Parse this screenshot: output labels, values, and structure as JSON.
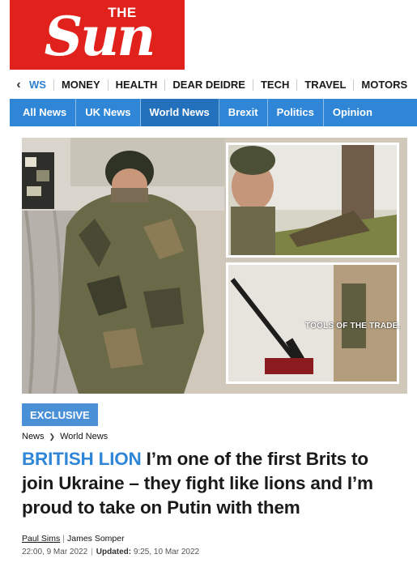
{
  "logo": {
    "the": "THE",
    "sun": "Sun"
  },
  "top_nav": {
    "items": [
      "WS",
      "MONEY",
      "HEALTH",
      "DEAR DEIDRE",
      "TECH",
      "TRAVEL",
      "MOTORS"
    ]
  },
  "section_nav": {
    "items": [
      "All News",
      "UK News",
      "World News",
      "Brexit",
      "Politics",
      "Opinion"
    ]
  },
  "hero": {
    "caption": "TOOLS OF THE TRADE."
  },
  "article": {
    "badge": "EXCLUSIVE",
    "breadcrumb": [
      "News",
      "World News"
    ],
    "kicker": "BRITISH LION",
    "headline": " I’m one of the first Brits to join Ukraine – they fight like lions and I’m proud to take on Putin with them",
    "authors": [
      "Paul Sims",
      "James Somper"
    ],
    "published": "22:00, 9 Mar 2022",
    "updated_label": "Updated:",
    "updated": "9:25, 10 Mar 2022"
  },
  "colors": {
    "brand_red": "#e1211b",
    "accent_blue": "#2f86d6",
    "badge_blue": "#4a90d6"
  }
}
